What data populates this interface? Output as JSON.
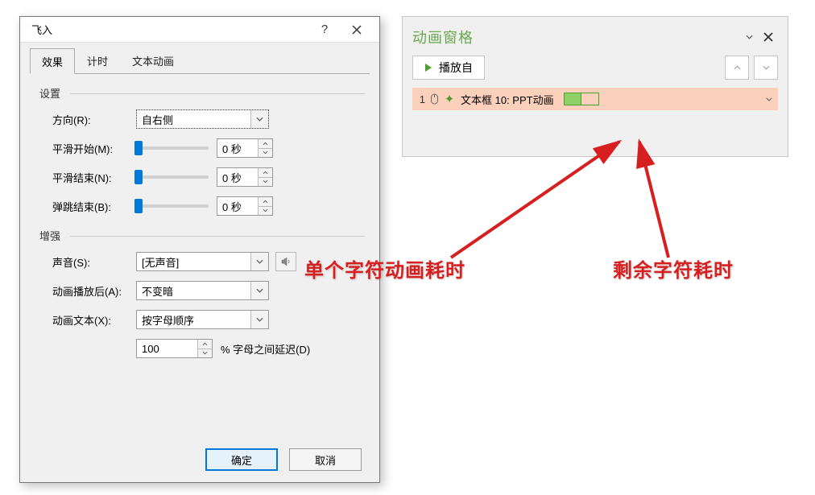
{
  "dialog": {
    "title": "飞入",
    "tabs": {
      "effect": "效果",
      "timing": "计时",
      "textAnim": "文本动画"
    },
    "section_settings": "设置",
    "section_enhance": "增强",
    "direction_label": "方向(R):",
    "direction_value": "自右侧",
    "smooth_start_label": "平滑开始(M):",
    "smooth_start_value": "0 秒",
    "smooth_end_label": "平滑结束(N):",
    "smooth_end_value": "0 秒",
    "bounce_end_label": "弹跳结束(B):",
    "bounce_end_value": "0 秒",
    "sound_label": "声音(S):",
    "sound_value": "[无声音]",
    "after_label": "动画播放后(A):",
    "after_value": "不变暗",
    "text_label": "动画文本(X):",
    "text_value": "按字母顺序",
    "delay_value": "100",
    "delay_label": "% 字母之间延迟(D)",
    "ok": "确定",
    "cancel": "取消"
  },
  "pane": {
    "title": "动画窗格",
    "play": "播放自",
    "item": {
      "num": "1",
      "name": "文本框 10: PPT动画"
    }
  },
  "annotations": {
    "left": "单个字符动画耗时",
    "right": "剩余字符耗时"
  }
}
